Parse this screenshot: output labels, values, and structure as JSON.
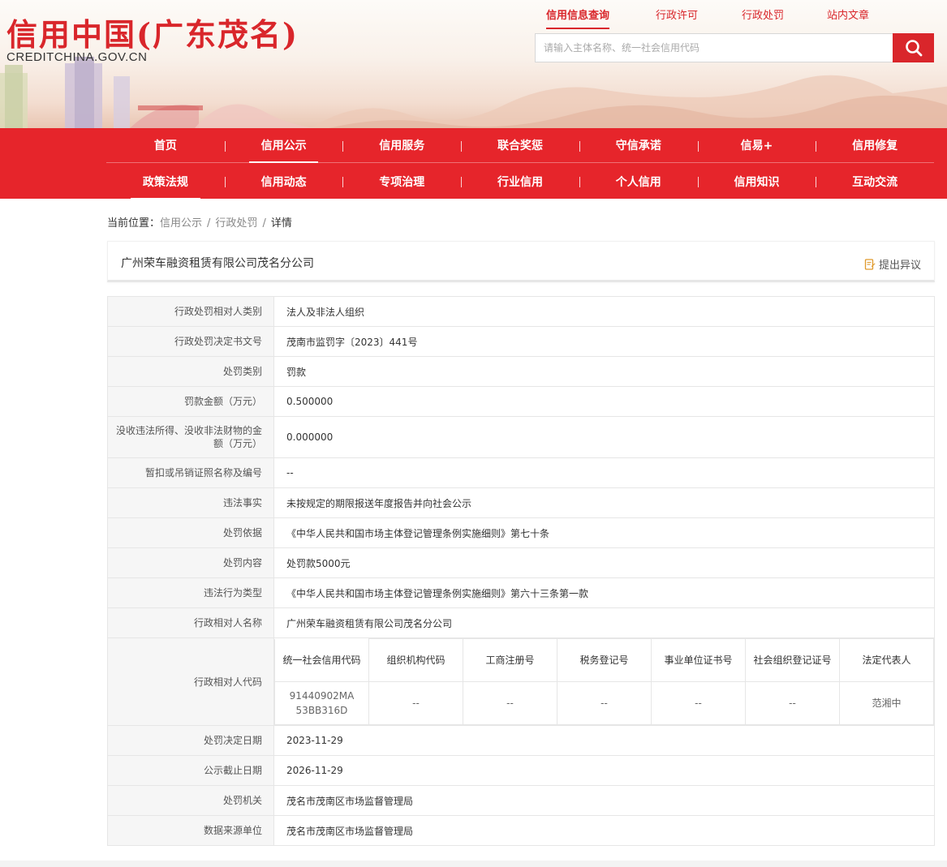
{
  "header": {
    "logo_cn": "信用中国(广东茂名)",
    "logo_en": "CREDITCHINA.GOV.CN",
    "top_links": [
      {
        "label": "信用信息查询",
        "active": true
      },
      {
        "label": "行政许可",
        "active": false
      },
      {
        "label": "行政处罚",
        "active": false
      },
      {
        "label": "站内文章",
        "active": false
      }
    ],
    "search_placeholder": "请输入主体名称、统一社会信用代码",
    "accent_color": "#d9262b"
  },
  "nav": {
    "row1": [
      "首页",
      "信用公示",
      "信用服务",
      "联合奖惩",
      "守信承诺",
      "信易+",
      "信用修复"
    ],
    "row2": [
      "政策法规",
      "信用动态",
      "专项治理",
      "行业信用",
      "个人信用",
      "信用知识",
      "互动交流"
    ],
    "active_row1": "信用公示",
    "active_row2": "政策法规"
  },
  "breadcrumb": {
    "prefix": "当前位置：",
    "items": [
      "信用公示",
      "行政处罚",
      "详情"
    ],
    "sep": "/"
  },
  "title": {
    "org_name": "广州荣车融资租赁有限公司茂名分公司",
    "objection_label": "提出异议"
  },
  "detail": {
    "rows_before": [
      {
        "key": "行政处罚相对人类别",
        "value": "法人及非法人组织",
        "h": 37
      },
      {
        "key": "行政处罚决定书文号",
        "value": "茂南市监罚字〔2023〕441号",
        "h": 37
      },
      {
        "key": "处罚类别",
        "value": "罚款",
        "h": 37
      },
      {
        "key": "罚款金额（万元）",
        "value": "0.500000",
        "h": 37
      },
      {
        "key": "没收违法所得、没收非法财物的金额（万元）",
        "value": "0.000000",
        "h": 51
      },
      {
        "key": "暂扣或吊销证照名称及编号",
        "value": "--",
        "h": 37
      },
      {
        "key": "违法事实",
        "value": "未按规定的期限报送年度报告并向社会公示",
        "h": 37
      },
      {
        "key": "处罚依据",
        "value": "《中华人民共和国市场主体登记管理条例实施细则》第七十条",
        "h": 37
      },
      {
        "key": "处罚内容",
        "value": "处罚款5000元",
        "h": 37
      },
      {
        "key": "违法行为类型",
        "value": "《中华人民共和国市场主体登记管理条例实施细则》第六十三条第一款",
        "h": 37
      },
      {
        "key": "行政相对人名称",
        "value": "广州荣车融资租赁有限公司茂名分公司",
        "h": 37
      }
    ],
    "code_row": {
      "key": "行政相对人代码",
      "headers": [
        "统一社会信用代码",
        "组织机构代码",
        "工商注册号",
        "税务登记号",
        "事业单位证书号",
        "社会组织登记证号",
        "法定代表人"
      ],
      "values": [
        "91440902MA53BB316D",
        "--",
        "--",
        "--",
        "--",
        "--",
        "范湘中"
      ]
    },
    "rows_after": [
      {
        "key": "处罚决定日期",
        "value": "2023-11-29",
        "h": 37
      },
      {
        "key": "公示截止日期",
        "value": "2026-11-29",
        "h": 37
      },
      {
        "key": "处罚机关",
        "value": "茂名市茂南区市场监督管理局",
        "h": 37
      },
      {
        "key": "数据来源单位",
        "value": "茂名市茂南区市场监督管理局",
        "h": 37
      }
    ]
  }
}
